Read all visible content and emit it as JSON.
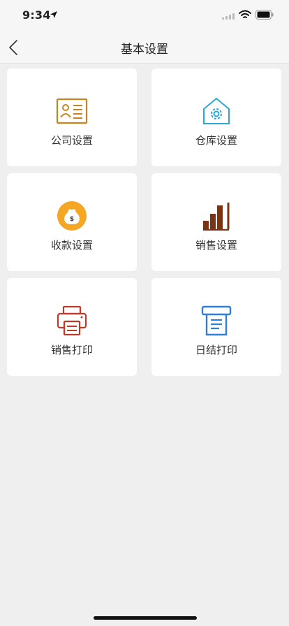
{
  "status_bar": {
    "time": "9:34"
  },
  "nav": {
    "title": "基本设置"
  },
  "menu": [
    {
      "label": "公司设置",
      "icon": "company-card-icon",
      "color": "#c8861a"
    },
    {
      "label": "仓库设置",
      "icon": "warehouse-gear-icon",
      "color": "#2aa8d8"
    },
    {
      "label": "收款设置",
      "icon": "money-bag-icon",
      "color": "#f5a623"
    },
    {
      "label": "销售设置",
      "icon": "bar-chart-icon",
      "color": "#7a3414"
    },
    {
      "label": "销售打印",
      "icon": "printer-icon",
      "color": "#c0392b"
    },
    {
      "label": "日结打印",
      "icon": "receipt-printer-icon",
      "color": "#2f7fd8"
    }
  ]
}
